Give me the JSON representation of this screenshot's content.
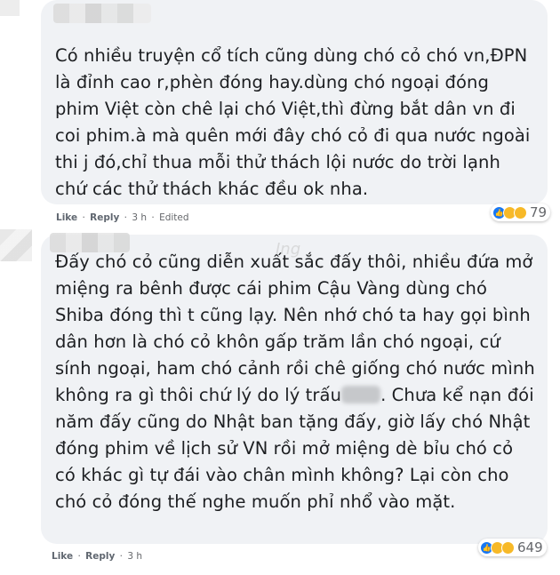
{
  "comments": [
    {
      "text": "Có nhiều truyện cổ tích cũng dùng chó cỏ chó vn,ĐPN là đỉnh cao r,phèn đóng hay.dùng chó ngoại đóng phim Việt còn chê lại chó Việt,thì đừng bắt dân vn đi coi phim.à mà quên mới đây chó cỏ đi qua nước ngoài thi j đó,chỉ thua mỗi thử thách lội nước do trời lạnh chứ các thử thách khác đều ok nha.",
      "like_label": "Like",
      "reply_label": "Reply",
      "time": "3 h",
      "edited": "Edited",
      "reaction_count": "79",
      "reactions": [
        "like-icon",
        "haha-icon",
        "wow-icon"
      ]
    },
    {
      "text_before": "Đấy chó cỏ cũng diễn xuất sắc đấy thôi, nhiều đứa mở miệng ra bênh được cái phim Cậu Vàng dùng chó Shiba đóng thì t cũng lạy. Nên nhớ chó ta hay gọi bình dân hơn là chó cỏ khôn gấp trăm lần chó ngoại, cứ sính ngoại, ham chó cảnh rồi chê giống chó nước mình không ra gì thôi chứ lý do lý trấu",
      "text_after": ". Chưa kể nạn đói năm đấy cũng do Nhật ban tặng đấy, giờ lấy chó Nhật đóng phim về lịch sử VN rồi mở miệng dè bỉu chó cỏ có khác gì tự đái vào chân mình không? Lại còn cho chó cỏ đóng thế nghe muốn phỉ nhổ vào mặt.",
      "like_label": "Like",
      "reply_label": "Reply",
      "time": "3 h",
      "reaction_count": "649",
      "reactions": [
        "like-icon",
        "haha-icon",
        "wow-icon"
      ]
    }
  ],
  "watermark": "Ing",
  "colors": {
    "bubble": "#f0f2f5",
    "text": "#1c1e21",
    "meta": "#65676b",
    "like_blue": "#1877f2",
    "haha_yellow": "#f7b928"
  }
}
